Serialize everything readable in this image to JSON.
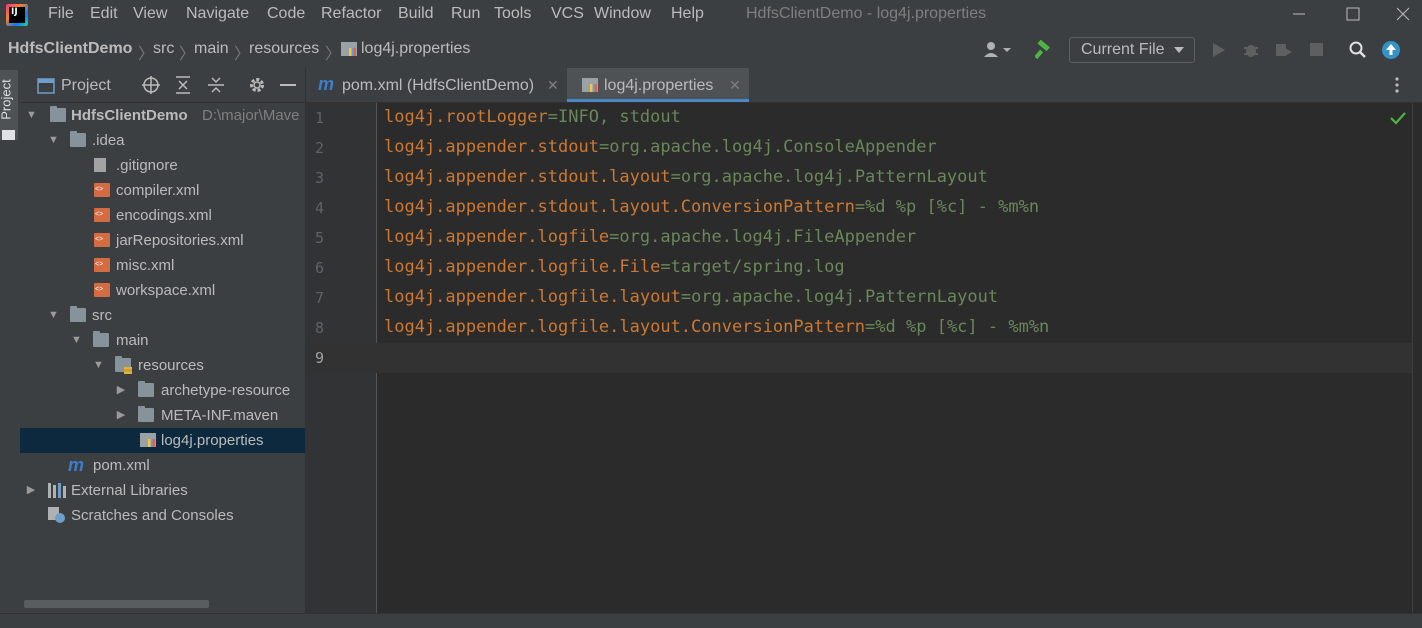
{
  "window": {
    "title": "HdfsClientDemo - log4j.properties",
    "app_icon": "intellij-idea-icon",
    "app_icon_letters": "IJ"
  },
  "menu": [
    {
      "label": "File"
    },
    {
      "label": "Edit"
    },
    {
      "label": "View"
    },
    {
      "label": "Navigate"
    },
    {
      "label": "Code"
    },
    {
      "label": "Refactor"
    },
    {
      "label": "Build"
    },
    {
      "label": "Run"
    },
    {
      "label": "Tools"
    },
    {
      "label": "VCS"
    },
    {
      "label": "Window"
    },
    {
      "label": "Help"
    }
  ],
  "breadcrumb": [
    "HdfsClientDemo",
    "src",
    "main",
    "resources",
    "log4j.properties"
  ],
  "toolbar": {
    "run_config": "Current File"
  },
  "project_panel": {
    "title": "Project",
    "tool_strip_label": "Project",
    "tree": [
      {
        "label": "HdfsClientDemo",
        "suffix": "D:\\major\\Mave",
        "type": "module"
      },
      {
        "label": ".idea",
        "type": "folder"
      },
      {
        "label": ".gitignore",
        "type": "ignore-file"
      },
      {
        "label": "compiler.xml",
        "type": "xml"
      },
      {
        "label": "encodings.xml",
        "type": "xml"
      },
      {
        "label": "jarRepositories.xml",
        "type": "xml"
      },
      {
        "label": "misc.xml",
        "type": "xml"
      },
      {
        "label": "workspace.xml",
        "type": "xml"
      },
      {
        "label": "src",
        "type": "folder"
      },
      {
        "label": "main",
        "type": "folder"
      },
      {
        "label": "resources",
        "type": "resources-folder"
      },
      {
        "label": "archetype-resource",
        "type": "folder"
      },
      {
        "label": "META-INF.maven",
        "type": "folder"
      },
      {
        "label": "log4j.properties",
        "type": "properties",
        "selected": true
      },
      {
        "label": "pom.xml",
        "type": "maven"
      },
      {
        "label": "External Libraries",
        "type": "libraries"
      },
      {
        "label": "Scratches and Consoles",
        "type": "scratches"
      }
    ]
  },
  "tabs": [
    {
      "label": "pom.xml (HdfsClientDemo)",
      "icon": "maven-icon"
    },
    {
      "label": "log4j.properties",
      "icon": "properties-file-icon",
      "active": true
    }
  ],
  "editor": {
    "line_numbers": [
      "1",
      "2",
      "3",
      "4",
      "5",
      "6",
      "7",
      "8",
      "9"
    ],
    "lines": [
      {
        "key": "log4j.rootLogger",
        "value": "INFO, stdout"
      },
      {
        "key": "log4j.appender.stdout",
        "value": "org.apache.log4j.ConsoleAppender"
      },
      {
        "key": "log4j.appender.stdout.layout",
        "value": "org.apache.log4j.PatternLayout"
      },
      {
        "key": "log4j.appender.stdout.layout.ConversionPattern",
        "value": "%d %p [%c] - %m%n"
      },
      {
        "key": "log4j.appender.logfile",
        "value": "org.apache.log4j.FileAppender"
      },
      {
        "key": "log4j.appender.logfile.File",
        "value": "target/spring.log"
      },
      {
        "key": "log4j.appender.logfile.layout",
        "value": "org.apache.log4j.PatternLayout"
      },
      {
        "key": "log4j.appender.logfile.layout.ConversionPattern",
        "value": "%d %p [%c] - %m%n"
      }
    ],
    "separator": "="
  },
  "colors": {
    "key": "#cc7832",
    "value": "#6a8759",
    "check": "#4db543",
    "build": "#4db543",
    "update": "#3592c4",
    "selection": "#0d293e"
  }
}
